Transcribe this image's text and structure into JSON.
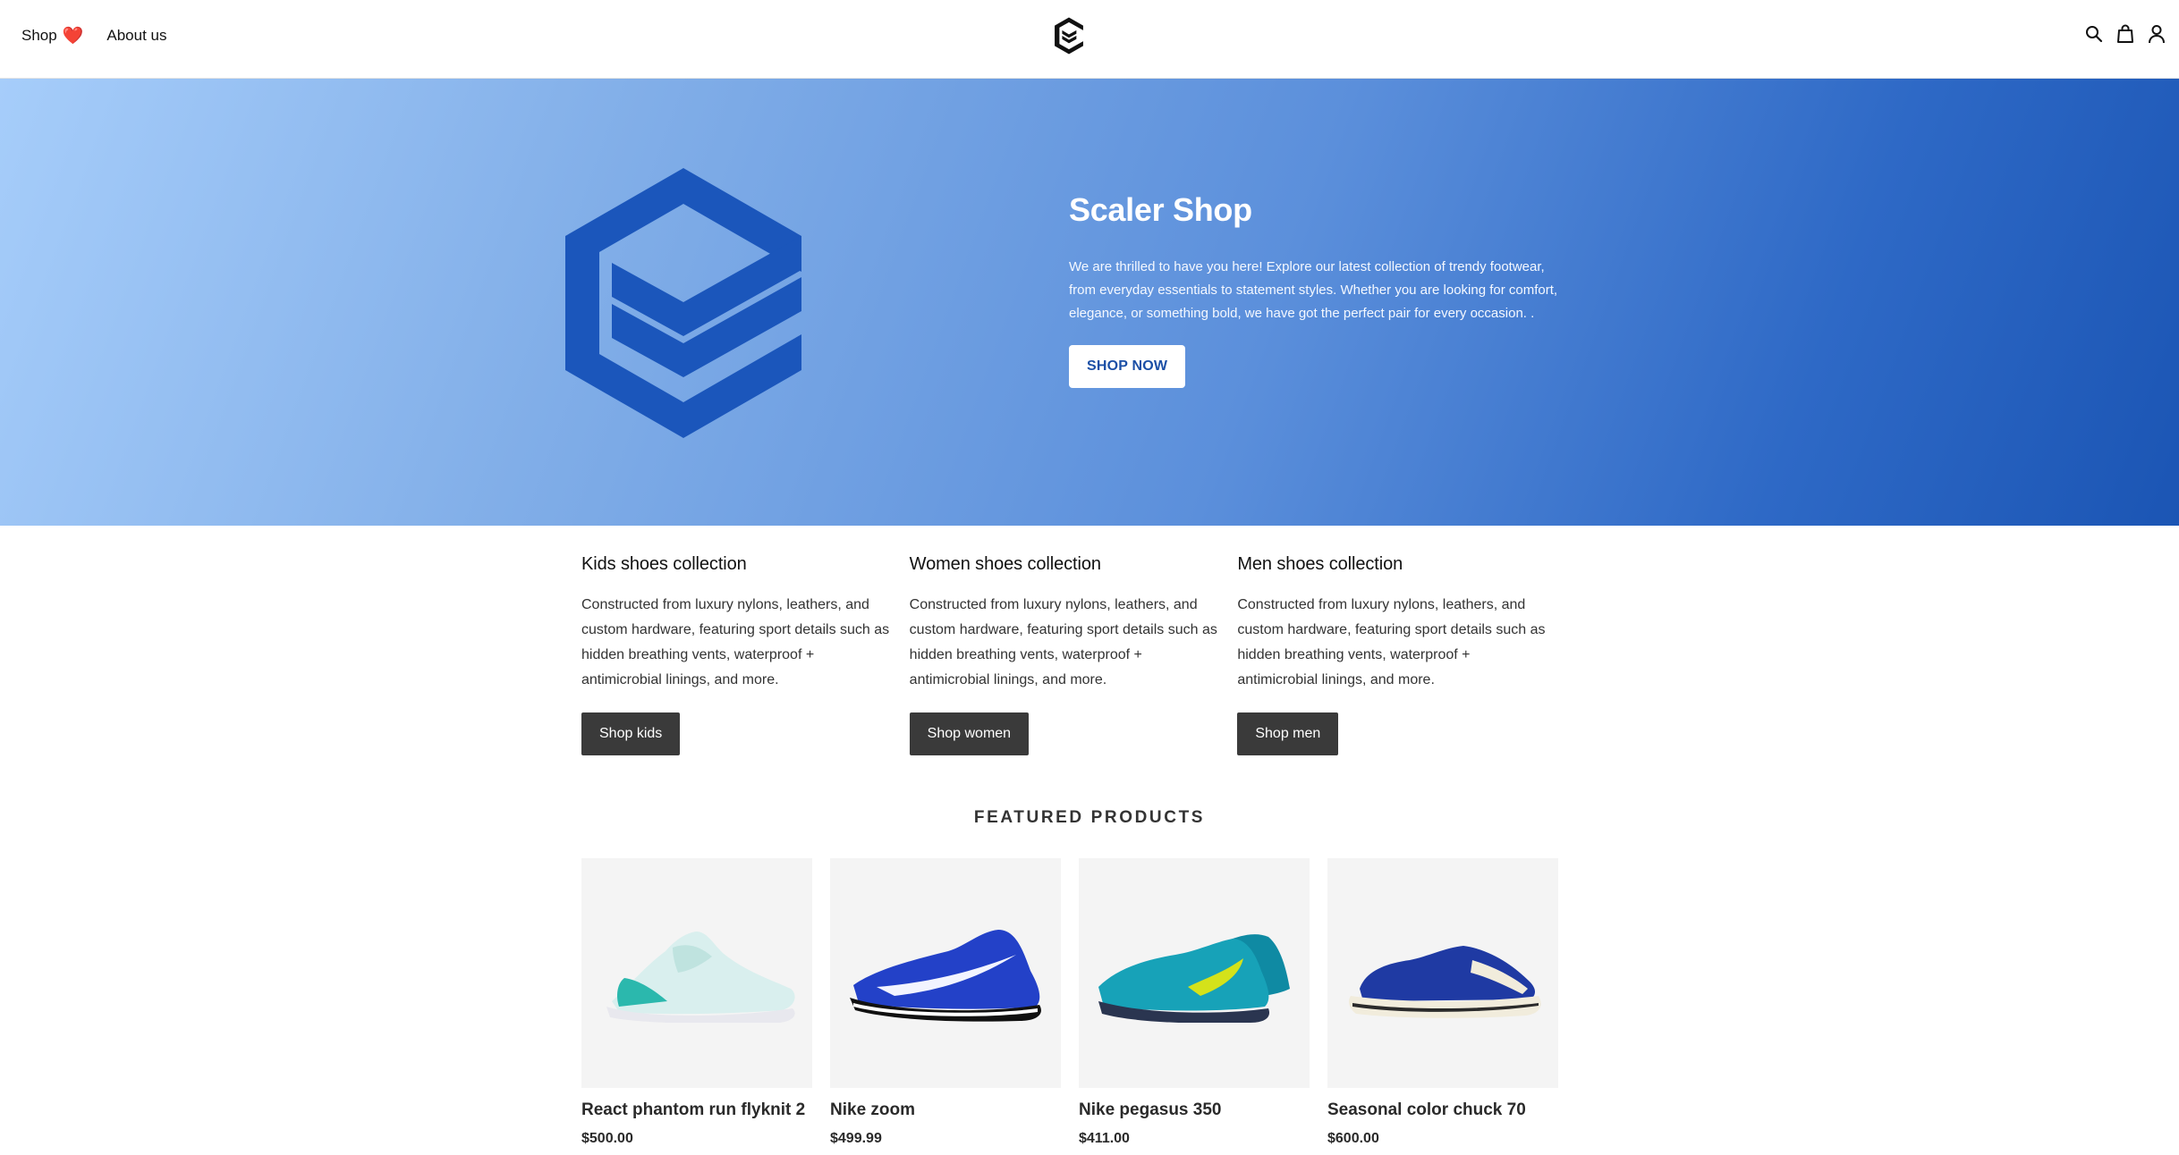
{
  "nav": {
    "shop_label": "Shop",
    "shop_heart": "❤️",
    "about_label": "About us",
    "brand_color": "#1b55b4",
    "icons": [
      "search-icon",
      "cart-icon",
      "user-icon"
    ]
  },
  "hero": {
    "title": "Scaler Shop",
    "description": "We are thrilled to have you here! Explore our latest collection of trendy footwear, from everyday essentials to statement styles. Whether you are looking for comfort, elegance, or something bold, we have got the perfect pair for every occasion. .",
    "button_label": "SHOP NOW",
    "gradient_start": "#a6cdfa",
    "gradient_end": "#1b55b4"
  },
  "collections": [
    {
      "title": "Kids shoes collection",
      "description": "Constructed from luxury nylons, leathers, and custom hardware, featuring sport details such as hidden breathing vents, waterproof + antimicrobial linings, and more.",
      "button_label": "Shop kids"
    },
    {
      "title": "Women shoes collection",
      "description": "Constructed from luxury nylons, leathers, and custom hardware, featuring sport details such as hidden breathing vents, waterproof + antimicrobial linings, and more.",
      "button_label": "Shop women"
    },
    {
      "title": "Men shoes collection",
      "description": "Constructed from luxury nylons, leathers, and custom hardware, featuring sport details such as hidden breathing vents, waterproof + antimicrobial linings, and more.",
      "button_label": "Shop men"
    }
  ],
  "featured": {
    "heading": "FEATURED PRODUCTS",
    "products": [
      {
        "name": "React phantom run flyknit 2",
        "price": "$500.00",
        "colors": [
          "#dff2f0",
          "#2bb8ad"
        ]
      },
      {
        "name": "Nike zoom",
        "price": "$499.99",
        "colors": [
          "#2341c8",
          "#ffffff"
        ]
      },
      {
        "name": "Nike pegasus 350",
        "price": "$411.00",
        "colors": [
          "#17a2b8",
          "#d4e21a"
        ]
      },
      {
        "name": "Seasonal color chuck 70",
        "price": "$600.00",
        "colors": [
          "#1f3aa3",
          "#f1ecdc"
        ]
      }
    ]
  }
}
